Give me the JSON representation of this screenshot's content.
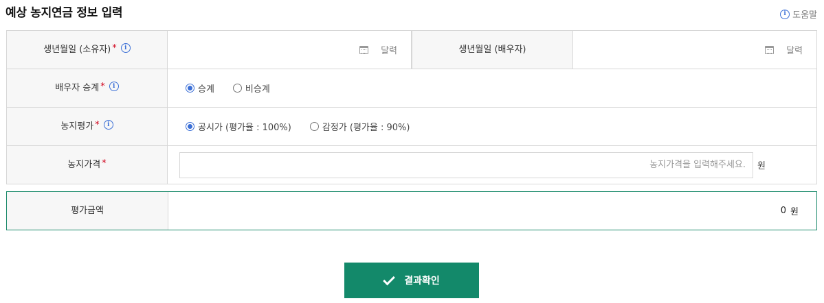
{
  "page": {
    "title": "예상 농지연금 정보 입력"
  },
  "help": {
    "label": "도움말"
  },
  "form": {
    "owner_birth": {
      "label": "생년월일 (소유자)",
      "required_mark": "*",
      "calendar_label": "달력"
    },
    "spouse_birth": {
      "label": "생년월일 (배우자)",
      "calendar_label": "달력"
    },
    "spouse_succession": {
      "label": "배우자 승계",
      "required_mark": "*",
      "options": [
        {
          "label": "승계",
          "checked": true
        },
        {
          "label": "비승계",
          "checked": false
        }
      ]
    },
    "land_valuation": {
      "label": "농지평가",
      "required_mark": "*",
      "options": [
        {
          "label": "공시가 (평가율 : 100%)",
          "checked": true
        },
        {
          "label": "감정가 (평가율 : 90%)",
          "checked": false
        }
      ]
    },
    "land_price": {
      "label": "농지가격",
      "required_mark": "*",
      "placeholder": "농지가격을 입력해주세요.",
      "unit": "원"
    }
  },
  "result": {
    "label": "평가금액",
    "value": "0",
    "unit": "원"
  },
  "confirm": {
    "label": "결과확인"
  },
  "colors": {
    "accent": "#13896a",
    "info": "#3b6fd6",
    "required": "#d0021b"
  }
}
